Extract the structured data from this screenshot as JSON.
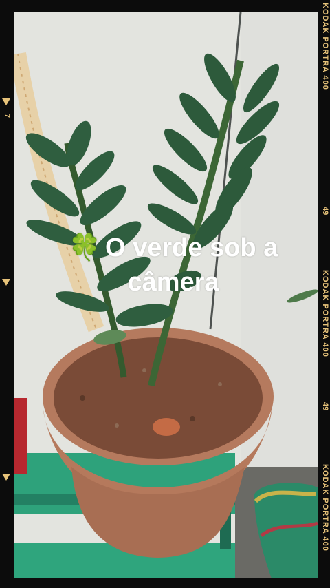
{
  "caption": {
    "icon": "four-leaf-clover-icon",
    "text": "O verde sob a câmera"
  },
  "film": {
    "brand_1": "KODAK PORTRA 400",
    "num_1": "49",
    "brand_2": "KODAK PORTRA 400",
    "num_2": "49",
    "brand_3": "KODAK PORTRA 400",
    "left_num": "7"
  },
  "colors": {
    "wall": "#e5e6e1",
    "pot": "#b77a5f",
    "soil": "#7a4a35",
    "leaf": "#2f5e3f",
    "stand": "#2a9f7b",
    "film_text": "#e7c37a"
  }
}
